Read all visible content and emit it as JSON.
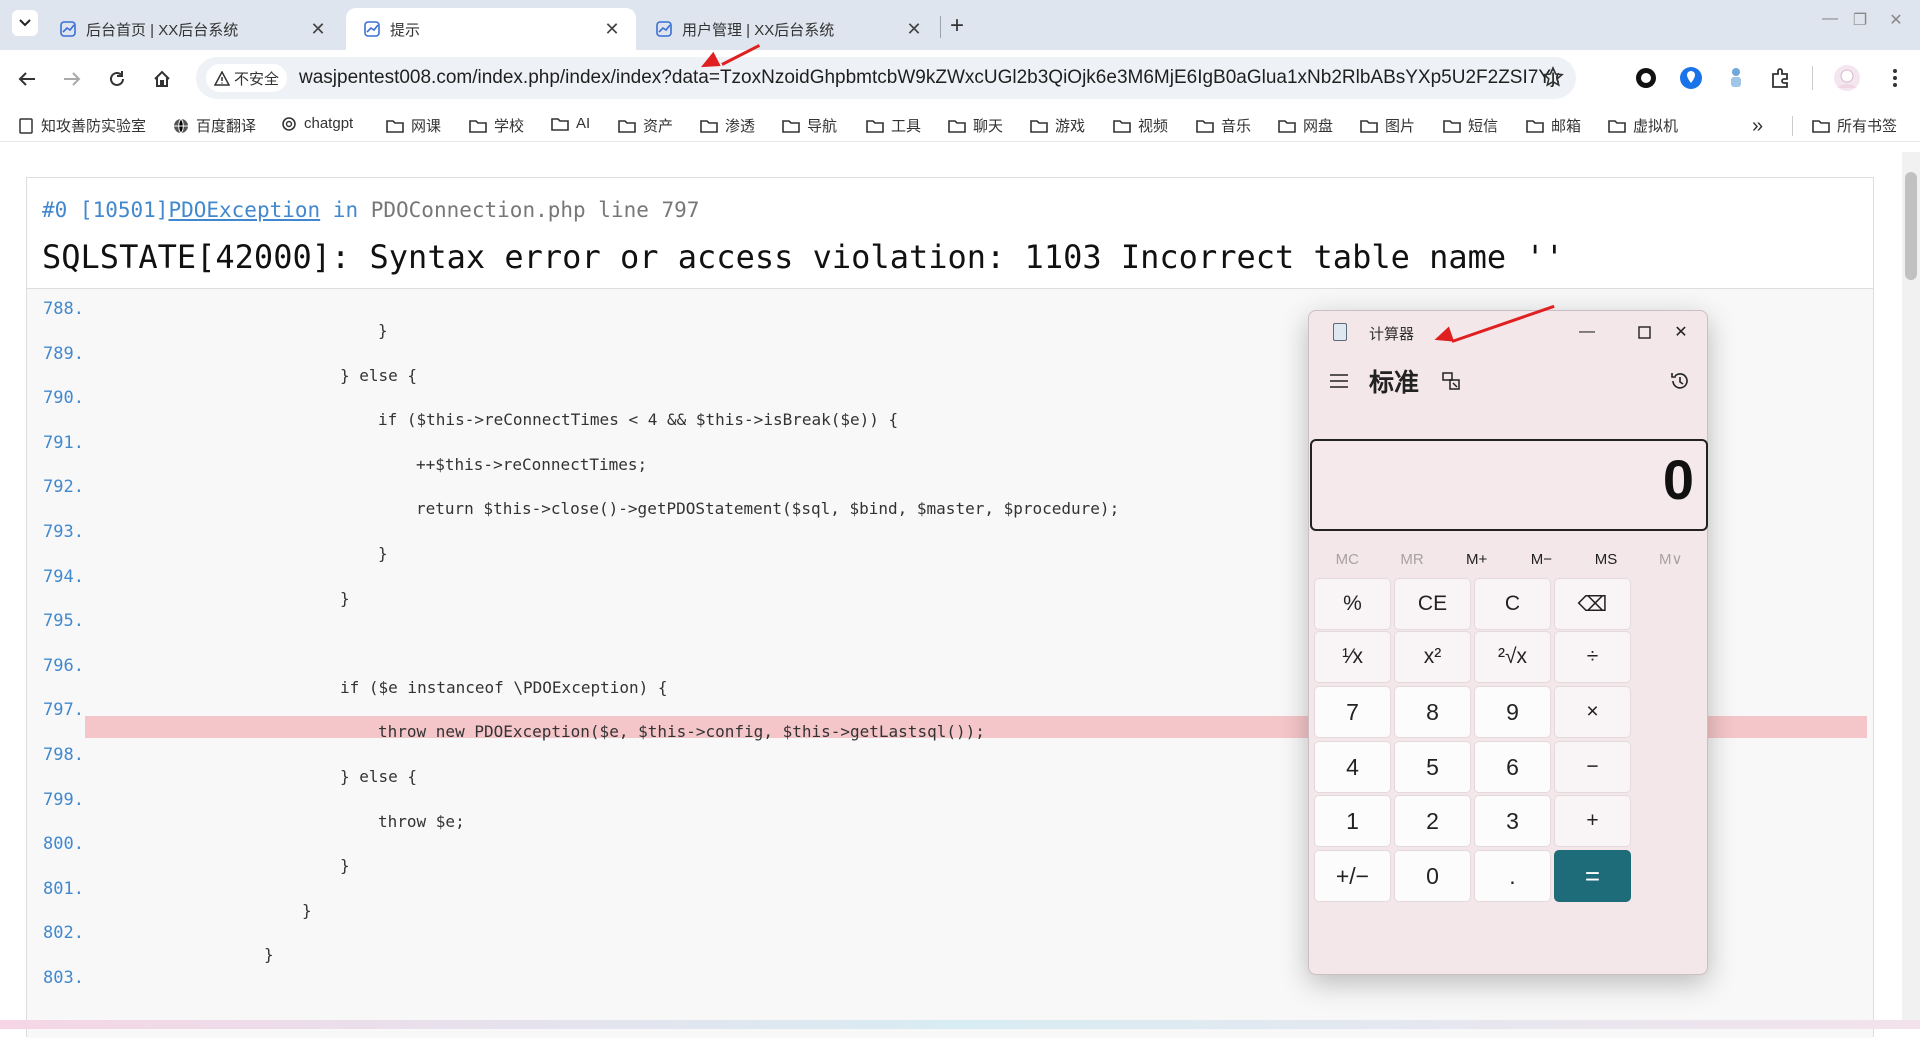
{
  "tabs": [
    {
      "title": "后台首页 | XX后台系统",
      "close": "✕"
    },
    {
      "title": "提示",
      "close": "✕"
    },
    {
      "title": "用户管理 | XX后台系统",
      "close": "✕"
    }
  ],
  "new_tab": "+",
  "address": {
    "security": "不安全",
    "url": "wasjpentest008.com/index.php/index/index?data=TzoxNzoidGhpbmtcbW9kZWxcUGl2b3QiOjk6e3M6MjE6IgB0aGlua1xNb2RlbABsYXp5U2F2ZSI7Yjo..."
  },
  "bookmarks": [
    "知攻善防实验室",
    "百度翻译",
    "chatgpt",
    "网课",
    "学校",
    "AI",
    "资产",
    "渗透",
    "导航",
    "工具",
    "聊天",
    "游戏",
    "视频",
    "音乐",
    "网盘",
    "图片",
    "短信",
    "邮箱",
    "虚拟机"
  ],
  "bookmarks_more": "»",
  "bookmarks_all": "所有书签",
  "error": {
    "head_prefix": "#0 [10501]",
    "exception": "PDOException",
    "in": " in ",
    "file": "PDOConnection.php line 797",
    "message": "SQLSTATE[42000]: Syntax error or access violation: 1103 Incorrect table name ''"
  },
  "code_lines": [
    {
      "n": "788.",
      "text": "}"
    },
    {
      "n": "789.",
      "text": "} else {"
    },
    {
      "n": "790.",
      "text": "if ($this->reConnectTimes < 4 && $this->isBreak($e)) {"
    },
    {
      "n": "791.",
      "text": "++$this->reConnectTimes;"
    },
    {
      "n": "792.",
      "text": "return $this->close()->getPDOStatement($sql, $bind, $master, $procedure);"
    },
    {
      "n": "793.",
      "text": "}"
    },
    {
      "n": "794.",
      "text": "}"
    },
    {
      "n": "795.",
      "text": ""
    },
    {
      "n": "796.",
      "text": "if ($e instanceof \\PDOException) {"
    },
    {
      "n": "797.",
      "text": "throw new PDOException($e, $this->config, $this->getLastsql());"
    },
    {
      "n": "798.",
      "text": "} else {"
    },
    {
      "n": "799.",
      "text": "throw $e;"
    },
    {
      "n": "800.",
      "text": "}"
    },
    {
      "n": "801.",
      "text": "}"
    },
    {
      "n": "802.",
      "text": "}"
    },
    {
      "n": "803.",
      "text": ""
    }
  ],
  "highlight_line": "797.",
  "calculator": {
    "title": "计算器",
    "mode": "标准",
    "display": "0",
    "memory": [
      "MC",
      "MR",
      "M+",
      "M−",
      "MS",
      "M∨"
    ],
    "keys": [
      [
        "%",
        "CE",
        "C",
        "⌫"
      ],
      [
        "¹⁄x",
        "x²",
        "²√x",
        "÷"
      ],
      [
        "7",
        "8",
        "9",
        "×"
      ],
      [
        "4",
        "5",
        "6",
        "−"
      ],
      [
        "1",
        "2",
        "3",
        "+"
      ],
      [
        "+/−",
        "0",
        ".",
        "="
      ]
    ],
    "accent": "#1e6b7a"
  }
}
